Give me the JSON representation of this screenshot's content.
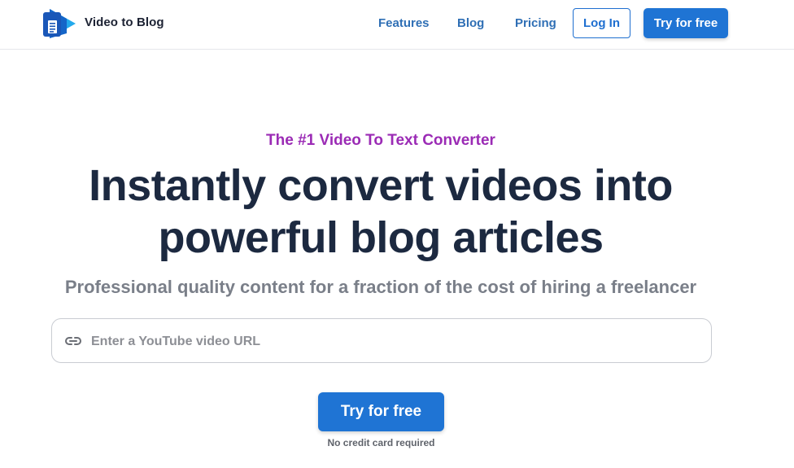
{
  "nav": {
    "brand": "Video to Blog",
    "links": [
      "Features",
      "Blog",
      "Pricing"
    ],
    "login_label": "Log In",
    "cta_label": "Try for free"
  },
  "hero": {
    "eyebrow": "The #1 Video To Text Converter",
    "headline_line1": "Instantly convert videos into",
    "headline_line2": "powerful blog articles",
    "subheadline": "Professional quality content for a fraction of the cost of hiring a freelancer",
    "url_placeholder": "Enter a YouTube video URL",
    "url_value": "",
    "cta_label": "Try for free",
    "cta_note": "No credit card required"
  },
  "icons": {
    "logo": "play-document-logo-icon",
    "url_field": "link-icon"
  },
  "colors": {
    "primary": "#1f74d4",
    "nav_link": "#2f6fb5",
    "eyebrow": "#9b2bb5",
    "headline": "#1c2940",
    "subhead": "#7a7f89"
  }
}
